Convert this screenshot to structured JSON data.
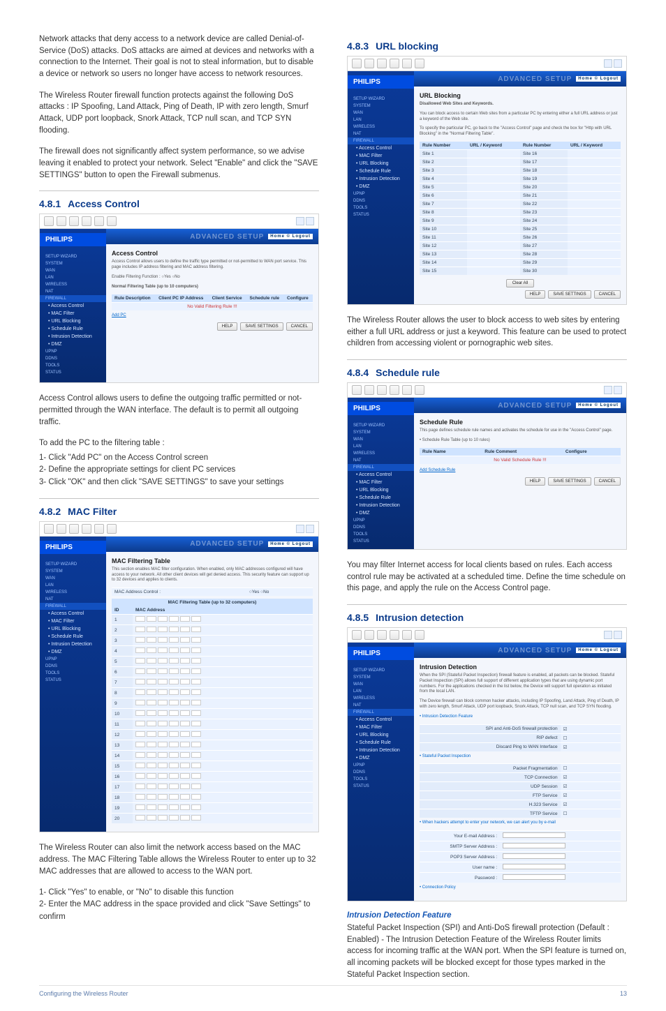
{
  "left": {
    "intro_p1": "Network attacks that deny access to a network device are called Denial-of-Service (DoS) attacks. DoS attacks are aimed at devices and networks with a connection to the Internet. Their goal is not to steal information, but to disable a device or network so users no longer have access to network resources.",
    "intro_p2": "The Wireless Router firewall function protects against the following DoS attacks : IP Spoofing, Land Attack, Ping of Death, IP with zero length, Smurf Attack, UDP port loopback, Snork Attack, TCP null scan, and TCP SYN flooding.",
    "intro_p3": "The firewall does not significantly affect system performance, so we advise leaving it enabled to protect your network. Select \"Enable\" and click the \"SAVE SETTINGS\" button to open the Firewall submenus.",
    "s1_num": "4.8.1",
    "s1_title": "Access Control",
    "s1_ss_title": "Access Control",
    "s1_ss_desc": "Access Control allows users to define the traffic type permitted or not-permitted to WAN port service. This page includes IP address filtering and MAC address filtering.",
    "s1_ss_enable": "Enable Filtering Function :  ○Yes  ○No",
    "s1_ss_tablelabel": "Normal Filtering Table (up to 10 computers)",
    "s1_ss_cols": {
      "c1": "Rule Description",
      "c2": "Client PC IP Address",
      "c3": "Client Service",
      "c4": "Schedule rule",
      "c5": "Configure"
    },
    "s1_ss_norule": "No Valid Filtering Rule !!!",
    "s1_ss_addpc": "Add PC",
    "s1_p1": "Access Control allows users to define the outgoing traffic permitted or not-permitted through the WAN interface. The default is to permit all outgoing traffic.",
    "s1_p2": "To add the PC to the filtering table :",
    "s1_l1": "1- Click \"Add PC\" on the Access Control screen",
    "s1_l2": "2- Define the appropriate settings for client PC services",
    "s1_l3": "3- Click \"OK\" and then click \"SAVE SETTINGS\" to save your settings",
    "s2_num": "4.8.2",
    "s2_title": "MAC Filter",
    "s2_ss_title": "MAC Filtering Table",
    "s2_ss_desc": "This section enables MAC filter configuration. When enabled, only MAC addresses configured will have access to your network. All other client devices will get denied access. This security feature can support up to 32 devices and applies to clients.",
    "s2_ss_col1": "MAC Address Control :",
    "s2_ss_col2": "○Yes  ○No",
    "s2_ss_tablehdr": "MAC Filtering Table (up to 32 computers)",
    "s2_ss_h_id": "ID",
    "s2_ss_h_mac": "MAC Address",
    "s2_p1": "The Wireless Router can also limit the network access based on the MAC address. The MAC Filtering Table allows the Wireless Router to enter up to 32 MAC addresses that are allowed to access to the WAN port.",
    "s2_l1": "1- Click \"Yes\" to enable, or \"No\" to disable this function",
    "s2_l2": "2- Enter the MAC address in the space provided and click \"Save Settings\" to confirm"
  },
  "right": {
    "s3_num": "4.8.3",
    "s3_title": "URL blocking",
    "s3_ss_title": "URL Blocking",
    "s3_ss_sub": "Disallowed Web Sites and Keywords.",
    "s3_ss_desc1": "You can block access to certain Web sites from a particular PC by entering either a full URL address or just a keyword of the Web site.",
    "s3_ss_desc2": "To specify the particular PC, go back to the \"Access Control\" page and check the box for \"Http with URL Blocking\" in the \"Normal Filtering Table\".",
    "s3_ss_h_rule": "Rule Number",
    "s3_ss_h_url": "URL / Keyword",
    "s3_p1": "The Wireless Router allows the user to block access to web sites by entering either a full URL address or just a keyword. This feature can be used to protect children from accessing violent or pornographic web sites.",
    "s4_num": "4.8.4",
    "s4_title": "Schedule rule",
    "s4_ss_title": "Schedule Rule",
    "s4_ss_desc": "This page defines schedule rule names and activates the schedule for use in the \"Access Control\" page.",
    "s4_ss_label": "• Schedule Rule Table (up to 10 rules)",
    "s4_ss_h1": "Rule Name",
    "s4_ss_h2": "Rule Comment",
    "s4_ss_h3": "Configure",
    "s4_ss_norule": "No Valid Schedule Rule !!!",
    "s4_ss_add": "Add Schedule Rule",
    "s4_p1": "You may filter Internet access for local clients based on rules. Each access control rule may be activated at a scheduled time. Define the time schedule on this page, and apply the rule on the Access Control page.",
    "s5_num": "4.8.5",
    "s5_title": "Intrusion detection",
    "s5_ss_title": "Intrusion Detection",
    "s5_ss_desc1": "When the SPI (Stateful Packet Inspection) firewall feature is enabled, all packets can be blocked. Stateful Packet Inspection (SPI) allows full support of different application types that are using dynamic port numbers. For the applications checked in the list below, the Device will support full operation as initiated from the local LAN.",
    "s5_ss_desc2": "The Device firewall can block common hacker attacks, including IP Spoofing, Land Attack, Ping of Death, IP with zero length, Smurf Attack, UDP port loopback, Snork Attack, TCP null scan, and TCP SYN flooding.",
    "s5_ss_sec1": "• Intrusion Detection Feature",
    "s5_ss_r1": "SPI and Anti-DoS firewall protection",
    "s5_ss_r2": "RIP defect",
    "s5_ss_r3": "Discard Ping to WAN Interface",
    "s5_ss_sec2": "• Stateful Packet Inspection",
    "s5_ss_r4": "Packet Fragmentation",
    "s5_ss_r5": "TCP Connection",
    "s5_ss_r6": "UDP Session",
    "s5_ss_r7": "FTP Service",
    "s5_ss_r8": "H.323 Service",
    "s5_ss_r9": "TFTP Service",
    "s5_ss_sec3": "• When hackers attempt to enter your network, we can alert you by e-mail",
    "s5_ss_f1": "Your E-mail Address :",
    "s5_ss_f2": "SMTP Server Address :",
    "s5_ss_f3": "POP3 Server Address :",
    "s5_ss_f4": "User name :",
    "s5_ss_f5": "Password :",
    "s5_ss_sec4": "• Connection Policy",
    "s5_sub": "Intrusion Detection Feature",
    "s5_p1": "Stateful Packet Inspection (SPI) and Anti-DoS firewall protection (Default : Enabled) - The Intrusion Detection Feature of the Wireless Router limits access for incoming traffic at the WAN port. When the SPI feature is turned on, all incoming packets will be blocked except for those types marked in the Stateful Packet Inspection section."
  },
  "nav": {
    "brand": "PHILIPS",
    "hdr": "ADVANCED SETUP",
    "lang": "Home  © Logout",
    "items": [
      "SETUP WIZARD",
      "SYSTEM",
      "WAN",
      "LAN",
      "WIRELESS",
      "NAT",
      "FIREWALL",
      "• Access Control",
      "• MAC Filter",
      "• URL Blocking",
      "• Schedule Rule",
      "• Intrusion Detection",
      "• DMZ",
      "UPnP",
      "DDNS",
      "TOOLS",
      "STATUS"
    ]
  },
  "buttons": {
    "help": "HELP",
    "save": "SAVE SETTINGS",
    "cancel": "CANCEL",
    "clear": "Clear All"
  },
  "footer": {
    "left": "Configuring the Wireless Router",
    "right": "13"
  }
}
